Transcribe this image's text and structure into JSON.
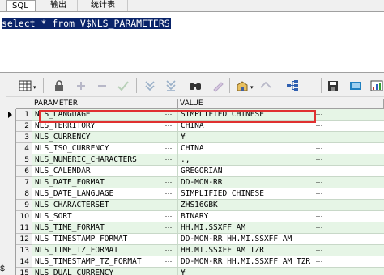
{
  "tabs": [
    {
      "label": "SQL"
    },
    {
      "label": "输出"
    },
    {
      "label": "统计表"
    }
  ],
  "editor": {
    "sql": "select * from V$NLS_PARAMETERS"
  },
  "gutter_mark": "$",
  "toolbar": {
    "icons": [
      "grid-icon",
      "lock-icon",
      "add-row-icon",
      "delete-row-icon",
      "post-icon",
      "next-page-icon",
      "last-page-icon",
      "find-icon",
      "clear-icon",
      "export-icon",
      "report-icon",
      "query-tree-icon",
      "save-icon",
      "print-icon",
      "chart-icon"
    ]
  },
  "grid": {
    "columns": [
      "PARAMETER",
      "VALUE"
    ],
    "rows": [
      {
        "n": "1",
        "parameter": "NLS_LANGUAGE",
        "value": "SIMPLIFIED CHINESE"
      },
      {
        "n": "2",
        "parameter": "NLS_TERRITORY",
        "value": "CHINA"
      },
      {
        "n": "3",
        "parameter": "NLS_CURRENCY",
        "value": "¥"
      },
      {
        "n": "4",
        "parameter": "NLS_ISO_CURRENCY",
        "value": "CHINA"
      },
      {
        "n": "5",
        "parameter": "NLS_NUMERIC_CHARACTERS",
        "value": ".,"
      },
      {
        "n": "6",
        "parameter": "NLS_CALENDAR",
        "value": "GREGORIAN"
      },
      {
        "n": "7",
        "parameter": "NLS_DATE_FORMAT",
        "value": "DD-MON-RR"
      },
      {
        "n": "8",
        "parameter": "NLS_DATE_LANGUAGE",
        "value": "SIMPLIFIED CHINESE"
      },
      {
        "n": "9",
        "parameter": "NLS_CHARACTERSET",
        "value": "ZHS16GBK"
      },
      {
        "n": "10",
        "parameter": "NLS_SORT",
        "value": "BINARY"
      },
      {
        "n": "11",
        "parameter": "NLS_TIME_FORMAT",
        "value": "HH.MI.SSXFF AM"
      },
      {
        "n": "12",
        "parameter": "NLS_TIMESTAMP_FORMAT",
        "value": "DD-MON-RR HH.MI.SSXFF AM"
      },
      {
        "n": "13",
        "parameter": "NLS_TIME_TZ_FORMAT",
        "value": "HH.MI.SSXFF AM TZR"
      },
      {
        "n": "14",
        "parameter": "NLS_TIMESTAMP_TZ_FORMAT",
        "value": "DD-MON-RR HH.MI.SSXFF AM TZR"
      },
      {
        "n": "15",
        "parameter": "NLS_DUAL_CURRENCY",
        "value": "¥"
      }
    ]
  },
  "colors": {
    "selection": "#0a246a",
    "row_alt": "#e6f5e6",
    "highlight": "#e03030"
  }
}
